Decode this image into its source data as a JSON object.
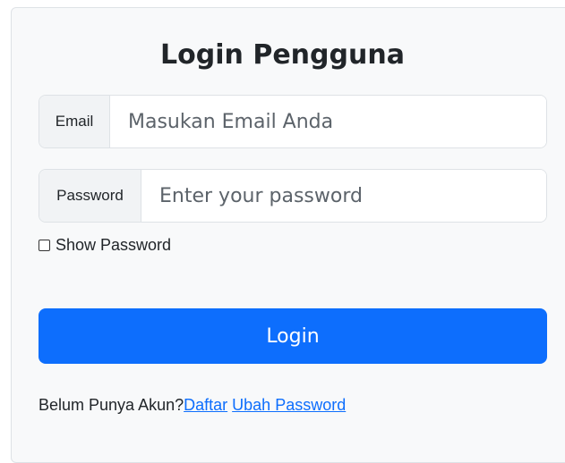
{
  "form": {
    "title": "Login Pengguna",
    "email": {
      "label": "Email",
      "placeholder": "Masukan Email Anda",
      "value": ""
    },
    "password": {
      "label": "Password",
      "placeholder": "Enter your password",
      "value": ""
    },
    "show_password": {
      "label": "Show Password",
      "checked": false
    },
    "login_button": "Login"
  },
  "footer": {
    "prompt": "Belum Punya Akun?",
    "register_link": "Daftar",
    "change_password_link": "Ubah Password"
  },
  "colors": {
    "primary": "#0d6efd",
    "card_background": "#f8f9fa",
    "addon_background": "#f1f3f5"
  }
}
